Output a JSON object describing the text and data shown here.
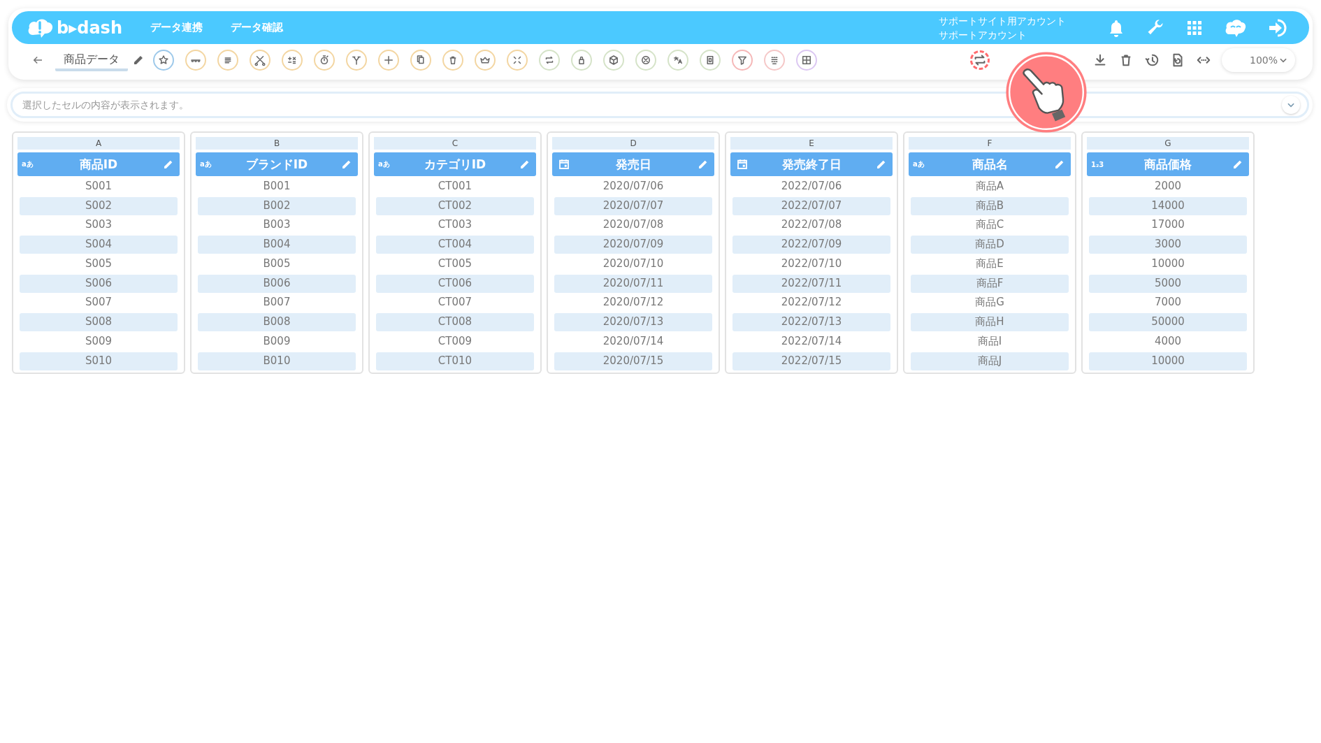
{
  "header": {
    "logo": "b▸dash",
    "nav": [
      "データ連携",
      "データ確認"
    ],
    "account": [
      "サポートサイト用アカウント",
      "サポートアカウント"
    ]
  },
  "toolbar": {
    "title": "商品データ",
    "tools": [
      {
        "color": "#9ec9ea"
      },
      {
        "color": "#f3d6a2"
      },
      {
        "color": "#f3d6a2"
      },
      {
        "color": "#f3d6a2"
      },
      {
        "color": "#f3d6a2"
      },
      {
        "color": "#f3d6a2"
      },
      {
        "color": "#f3d6a2"
      },
      {
        "color": "#f3d6a2"
      },
      {
        "color": "#f3d6a2"
      },
      {
        "color": "#f3d6a2"
      },
      {
        "color": "#f3d6a2"
      },
      {
        "color": "#f3d6a2"
      },
      {
        "color": "#d5e3c8"
      },
      {
        "color": "#d5e3c8"
      },
      {
        "color": "#d5e3c8"
      },
      {
        "color": "#d5e3c8"
      },
      {
        "color": "#d5e3c8"
      },
      {
        "color": "#d5e3c8"
      },
      {
        "color": "#f5b8b8"
      },
      {
        "color": "#f5c8c8"
      },
      {
        "color": "#dcc8f2"
      }
    ],
    "right_tools": [
      {
        "highlighted": true
      },
      {
        "highlighted": false
      },
      {
        "highlighted": false
      },
      {
        "highlighted": false
      },
      {
        "highlighted": false
      },
      {
        "highlighted": false
      }
    ],
    "zoom": "100%"
  },
  "formula_bar": {
    "placeholder": "選択したセルの内容が表示されます。"
  },
  "columns": [
    {
      "letter": "A",
      "name": "商品ID",
      "kind": "text",
      "type_badge": "aあ",
      "cells": [
        "S001",
        "S002",
        "S003",
        "S004",
        "S005",
        "S006",
        "S007",
        "S008",
        "S009",
        "S010"
      ]
    },
    {
      "letter": "B",
      "name": "ブランドID",
      "kind": "text",
      "type_badge": "aあ",
      "cells": [
        "B001",
        "B002",
        "B003",
        "B004",
        "B005",
        "B006",
        "B007",
        "B008",
        "B009",
        "B010"
      ]
    },
    {
      "letter": "C",
      "name": "カテゴリID",
      "kind": "text",
      "type_badge": "aあ",
      "cells": [
        "CT001",
        "CT002",
        "CT003",
        "CT004",
        "CT005",
        "CT006",
        "CT007",
        "CT008",
        "CT009",
        "CT010"
      ]
    },
    {
      "letter": "D",
      "name": "発売日",
      "kind": "date",
      "cells": [
        "2020/07/06",
        "2020/07/07",
        "2020/07/08",
        "2020/07/09",
        "2020/07/10",
        "2020/07/11",
        "2020/07/12",
        "2020/07/13",
        "2020/07/14",
        "2020/07/15"
      ]
    },
    {
      "letter": "E",
      "name": "発売終了日",
      "kind": "date",
      "cells": [
        "2022/07/06",
        "2022/07/07",
        "2022/07/08",
        "2022/07/09",
        "2022/07/10",
        "2022/07/11",
        "2022/07/12",
        "2022/07/13",
        "2022/07/14",
        "2022/07/15"
      ]
    },
    {
      "letter": "F",
      "name": "商品名",
      "kind": "text",
      "type_badge": "aあ",
      "cells": [
        "商品A",
        "商品B",
        "商品C",
        "商品D",
        "商品E",
        "商品F",
        "商品G",
        "商品H",
        "商品I",
        "商品J"
      ]
    },
    {
      "letter": "G",
      "name": "商品価格",
      "kind": "number",
      "type_badge": "1₂3",
      "cells": [
        "2000",
        "14000",
        "17000",
        "3000",
        "10000",
        "5000",
        "7000",
        "50000",
        "4000",
        "10000"
      ]
    }
  ]
}
